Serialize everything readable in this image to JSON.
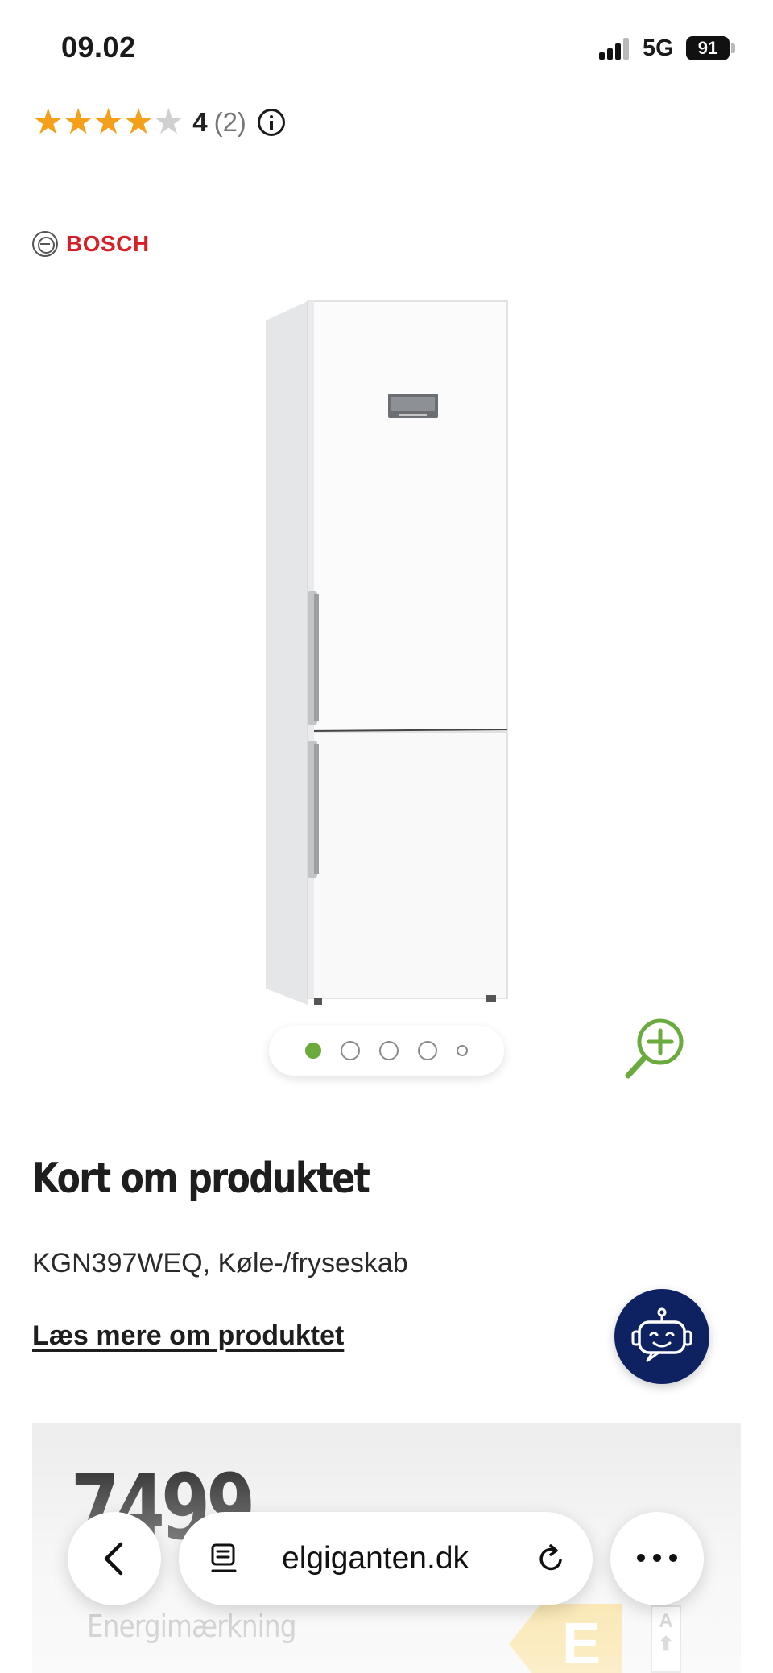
{
  "status_bar": {
    "time": "09.02",
    "network": "5G",
    "battery": "91"
  },
  "rating": {
    "value": "4",
    "count": "(2)",
    "stars_filled": 4,
    "stars_total": 5
  },
  "brand": {
    "name": "BOSCH"
  },
  "carousel": {
    "active_index": 0,
    "count": 5
  },
  "summary": {
    "title": "Kort om produktet",
    "description": "KGN397WEQ, Køle-/fryseskab",
    "read_more": "Læs mere om produktet"
  },
  "price": {
    "amount": "7499"
  },
  "energy": {
    "label": "Energimærkning",
    "class": "E",
    "scale_top": "A"
  },
  "browser": {
    "url": "elgiganten.dk"
  },
  "colors": {
    "accent_green": "#6bab3e",
    "star": "#f5a01a",
    "brand_red": "#d61f26",
    "chat_navy": "#0e2262",
    "energy_yellow": "#f3c64a"
  }
}
